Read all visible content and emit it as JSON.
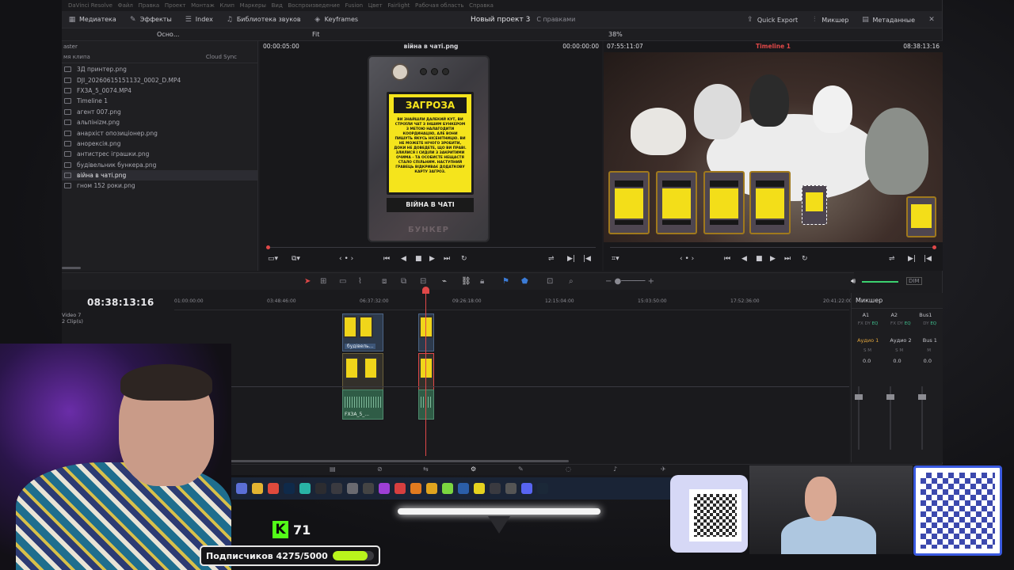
{
  "resolve": {
    "toolbar": {
      "media_pool": "Медиатека",
      "effects": "Эффекты",
      "index": "Index",
      "sound_library": "Библиотека звуков",
      "keyframes": "Keyframes",
      "project_title": "Новый проект 3",
      "project_status": "С правками",
      "quick_export": "Quick Export",
      "mixer": "Микшер",
      "metadata": "Метаданные"
    },
    "subtool": {
      "view_mode": "Осно...",
      "fit": "Fit",
      "zoom": "38%"
    },
    "media_pool": {
      "folder": "aster",
      "col_name": "мя клипа",
      "cloud": "Cloud Sync",
      "items": [
        {
          "name": "3Д принтер.png",
          "selected": false
        },
        {
          "name": "DJI_20260615151132_0002_D.MP4",
          "selected": false
        },
        {
          "name": "FX3A_5_0074.MP4",
          "selected": false
        },
        {
          "name": "Timeline 1",
          "selected": false
        },
        {
          "name": "агент 007.png",
          "selected": false
        },
        {
          "name": "альпініzм.png",
          "selected": false
        },
        {
          "name": "анархіст опозиціонер.png",
          "selected": false
        },
        {
          "name": "анорексія.png",
          "selected": false
        },
        {
          "name": "антистрес іграшки.png",
          "selected": false
        },
        {
          "name": "будівельник бункера.png",
          "selected": false
        },
        {
          "name": "війна в чаті.png",
          "selected": true
        },
        {
          "name": "гном 152 роки.png",
          "selected": false
        }
      ]
    },
    "source_viewer": {
      "tc_left": "00:00:05:00",
      "clip_name": "війна в чаті.png",
      "tc_right": "00:00:00:00",
      "card": {
        "title": "ЗАГРОЗА",
        "body": "ВИ ЗНАЙШЛИ ДАЛЕКИЙ КУТ, ВИ СТРОЇЛИ ЧАТ З ІНШИМ БУНКЕРОМ З МЕТОЮ НАЛАГОДИТИ КООРДИНАЦІЮ, АЛЕ ВОНИ ПИШУТЬ ЯКУСЬ НІСЕНІТНИЦЮ. ВИ НЕ МОЖЕТЕ НІЧОГО ЗРОБИТИ, ДОКИ НЕ ДОВЕДЕТЕ, ЩО ВИ ПРАВІ. ЗЛИЛИСЯ І СИДІЛИ З ЗАКРИТИМИ ОЧИМА – ТА ОСОБИСТЕ НЕЩАСТЯ СТАЛО СПІЛЬНИМ. НАСТУПНИЙ ГРАВЕЦЬ ВІДКРИВАЄ ДОДАТКОВУ КАРТУ ЗАГРОЗ.",
        "footer": "ВІЙНА В ЧАТІ",
        "brand": "БУНКЕР"
      }
    },
    "timeline_viewer": {
      "tc_left": "07:55:11:07",
      "timeline_name": "Timeline 1",
      "tc_right": "08:38:13:16"
    },
    "timeline": {
      "timecode": "08:38:13:16",
      "track_name": "Video 7",
      "track_clips": "2 Clip(s)",
      "ruler": [
        "01:00:00:00",
        "03:48:46:00",
        "06:37:32:00",
        "09:26:18:00",
        "12:15:04:00",
        "15:03:50:00",
        "17:52:36:00",
        "20:41:22:00"
      ],
      "video_clip_label": "будівель...",
      "audio_clip_label": "FX3A_5_..."
    },
    "mixer": {
      "title": "Микшер",
      "cols": [
        "A1",
        "A2",
        "Bus1"
      ],
      "names": [
        "Аудио 1",
        "Аудио 2",
        "Bus 1"
      ],
      "levels": [
        "0.0",
        "0.0",
        "0.0"
      ],
      "dim": "DIM"
    }
  },
  "overlay": {
    "kick_count": "71",
    "subs_label": "Подписчиков 4275/5000",
    "subs_progress": 0.855
  }
}
